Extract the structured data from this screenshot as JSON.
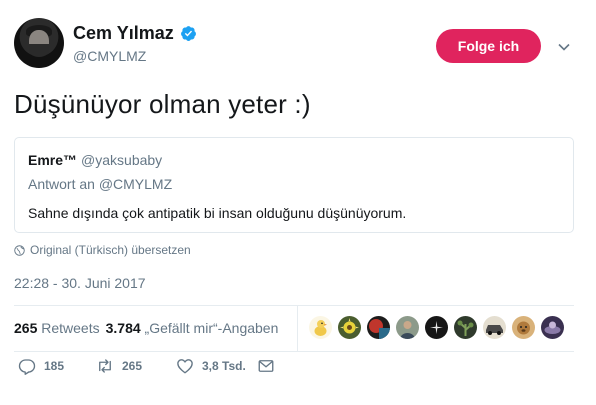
{
  "author": {
    "name": "Cem Yılmaz",
    "handle": "@CMYLMZ",
    "follow_label": "Folge ich"
  },
  "tweet": {
    "text": "Düşünüyor olman yeter :)",
    "translate_label": "Original (Türkisch) übersetzen",
    "timestamp": "22:28 - 30. Juni 2017"
  },
  "quoted_tweet": {
    "name": "Emre™",
    "handle": "@yaksubaby",
    "reply_to": "Antwort an @CMYLMZ",
    "text": "Sahne dışında çok antipatik bi insan olduğunu düşünüyorum."
  },
  "stats": {
    "retweets_count": "265",
    "retweets_label": "Retweets",
    "likes_count": "3.784",
    "likes_label": "„Gefällt mir“-Angaben"
  },
  "likers": [
    {
      "icon": "chick-avatar",
      "color": "#f2e6b8"
    },
    {
      "icon": "flower-avatar",
      "color": "#4a5d2e"
    },
    {
      "icon": "red-black-avatar",
      "color": "#b8322a"
    },
    {
      "icon": "person-avatar",
      "color": "#6a7468"
    },
    {
      "icon": "dark-burst-avatar",
      "color": "#1b1b1b"
    },
    {
      "icon": "plant-avatar",
      "color": "#3f4a3a"
    },
    {
      "icon": "car-avatar",
      "color": "#d8d2c4"
    },
    {
      "icon": "animal-avatar",
      "color": "#b07a3c"
    },
    {
      "icon": "portrait-avatar",
      "color": "#7a4a3a"
    },
    {
      "icon": "purple-avatar",
      "color": "#3a3050"
    }
  ],
  "actions": {
    "reply_count": "185",
    "retweet_count": "265",
    "like_count": "3,8 Tsd."
  },
  "colors": {
    "follow_button": "#e0245e",
    "verified": "#1da1f2",
    "secondary_text": "#657786"
  }
}
